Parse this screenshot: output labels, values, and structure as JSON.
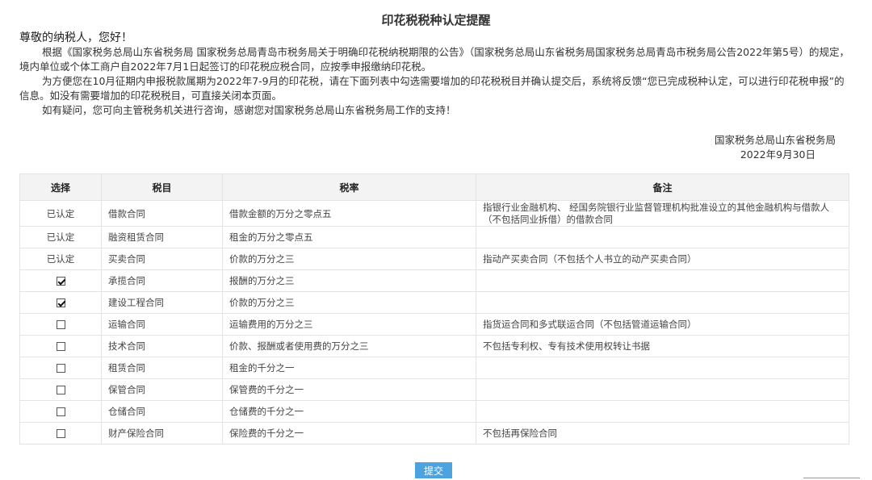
{
  "notice": {
    "title": "印花税税种认定提醒",
    "greeting": "尊敬的纳税人，您好！",
    "paragraphs": [
      "根据《国家税务总局山东省税务局 国家税务总局青岛市税务局关于明确印花税纳税期限的公告》（国家税务总局山东省税务局国家税务总局青岛市税务局公告2022年第5号）的规定，境内单位或个体工商户自2022年7月1日起签订的印花税应税合同，应按季申报缴纳印花税。",
      "为方便您在10月征期内申报税款属期为2022年7-9月的印花税，请在下面列表中勾选需要增加的印花税税目并确认提交后，系统将反馈“您已完成税种认定，可以进行印花税申报”的信息。如没有需要增加的印花税税目，可直接关闭本页面。",
      "如有疑问，您可向主管税务机关进行咨询，感谢您对国家税务总局山东省税务局工作的支持！"
    ],
    "signer": "国家税务总局山东省税务局",
    "date": "2022年9月30日"
  },
  "table": {
    "headers": {
      "select": "选择",
      "item": "税目",
      "rate": "税率",
      "note": "备注"
    },
    "rows": [
      {
        "status": "已认定",
        "checkbox": null,
        "item": "借款合同",
        "rate": "借款金额的万分之零点五",
        "note": "指银行业金融机构、 经国务院银行业监督管理机构批准设立的其他金融机构与借款人（不包括同业拆借）的借款合同"
      },
      {
        "status": "已认定",
        "checkbox": null,
        "item": "融资租赁合同",
        "rate": "租金的万分之零点五",
        "note": ""
      },
      {
        "status": "已认定",
        "checkbox": null,
        "item": "买卖合同",
        "rate": "价款的万分之三",
        "note": "指动产买卖合同（不包括个人书立的动产买卖合同）"
      },
      {
        "status": "",
        "checkbox": true,
        "item": "承揽合同",
        "rate": "报酬的万分之三",
        "note": ""
      },
      {
        "status": "",
        "checkbox": true,
        "item": "建设工程合同",
        "rate": "价款的万分之三",
        "note": ""
      },
      {
        "status": "",
        "checkbox": false,
        "item": "运输合同",
        "rate": "运输费用的万分之三",
        "note": "指货运合同和多式联运合同（不包括管道运输合同）"
      },
      {
        "status": "",
        "checkbox": false,
        "item": "技术合同",
        "rate": "价款、报酬或者使用费的万分之三",
        "note": "不包括专利权、专有技术使用权转让书据"
      },
      {
        "status": "",
        "checkbox": false,
        "item": "租赁合同",
        "rate": "租金的千分之一",
        "note": ""
      },
      {
        "status": "",
        "checkbox": false,
        "item": "保管合同",
        "rate": "保管费的千分之一",
        "note": ""
      },
      {
        "status": "",
        "checkbox": false,
        "item": "仓储合同",
        "rate": "仓储费的千分之一",
        "note": ""
      },
      {
        "status": "",
        "checkbox": false,
        "item": "财产保险合同",
        "rate": "保险费的千分之一",
        "note": "不包括再保险合同"
      }
    ]
  },
  "actions": {
    "submit_label": "提交"
  },
  "colors": {
    "submit_bg": "#4da3e0",
    "header_bg": "#f3f3f3"
  }
}
